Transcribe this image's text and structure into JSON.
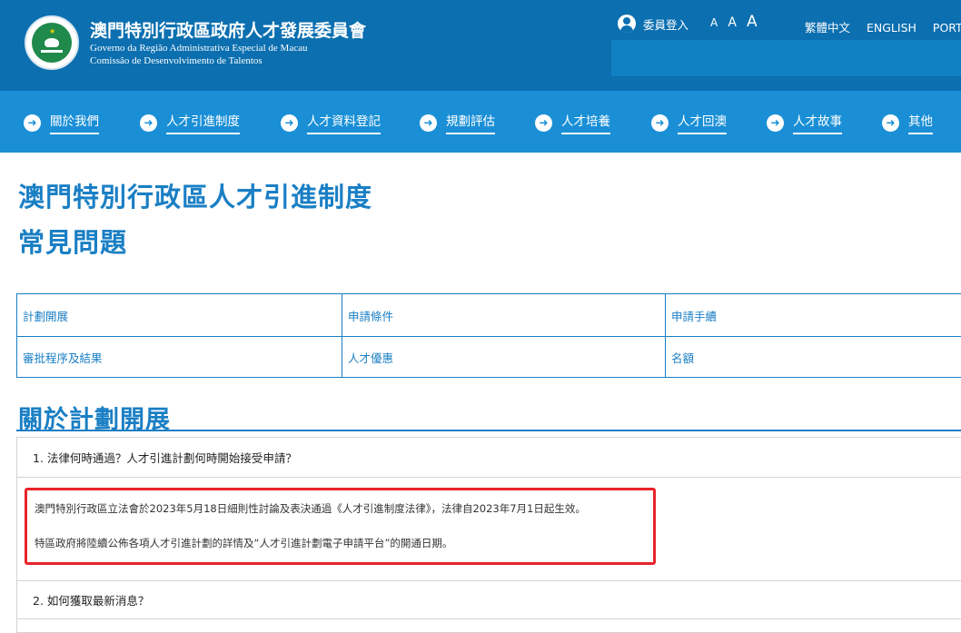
{
  "header": {
    "title_zh": "澳門特別行政區政府人才發展委員會",
    "title_pt_line1": "Governo da Região Administrativa Especial de Macau",
    "title_pt_line2": "Comissão de Desenvolvimento de Talentos",
    "member_login": "委員登入",
    "font_sizes": [
      "A",
      "A",
      "A"
    ],
    "languages": [
      "繁體中文",
      "ENGLISH",
      "PORTU"
    ]
  },
  "nav": {
    "items": [
      {
        "label": "關於我們",
        "icon": "arrow-right-icon"
      },
      {
        "label": "人才引進制度",
        "icon": "arrow-right-icon"
      },
      {
        "label": "人才資料登記",
        "icon": "arrow-right-icon"
      },
      {
        "label": "規劃評估",
        "icon": "arrow-right-icon"
      },
      {
        "label": "人才培養",
        "icon": "arrow-right-icon"
      },
      {
        "label": "人才回澳",
        "icon": "arrow-right-icon"
      },
      {
        "label": "人才故事",
        "icon": "arrow-right-icon"
      },
      {
        "label": "其他",
        "icon": "arrow-right-icon"
      }
    ],
    "arrow_glyph": "➜"
  },
  "page": {
    "title_line1": "澳門特別行政區人才引進制度",
    "title_line2": "常見問題"
  },
  "categories": [
    [
      "計劃開展",
      "申請條件",
      "申請手續"
    ],
    [
      "審批程序及結果",
      "人才優惠",
      "名額"
    ]
  ],
  "section": {
    "title": "關於計劃開展"
  },
  "faq": [
    {
      "question": "1. 法律何時通過？人才引進計劃何時開始接受申請？",
      "answer": [
        "澳門特別行政區立法會於2023年5月18日細則性討論及表決通過《人才引進制度法律》，法律自2023年7月1日起生效。",
        "特區政府將陸續公佈各項人才引進計劃的詳情及“人才引進計劃電子申請平台”的開通日期。"
      ]
    },
    {
      "question": "2. 如何獲取最新消息？"
    }
  ],
  "colors": {
    "header_bg": "#0b6fb0",
    "nav_bg": "#1a8fd6",
    "accent": "#1a7fc4",
    "highlight_border": "#e8242a"
  }
}
